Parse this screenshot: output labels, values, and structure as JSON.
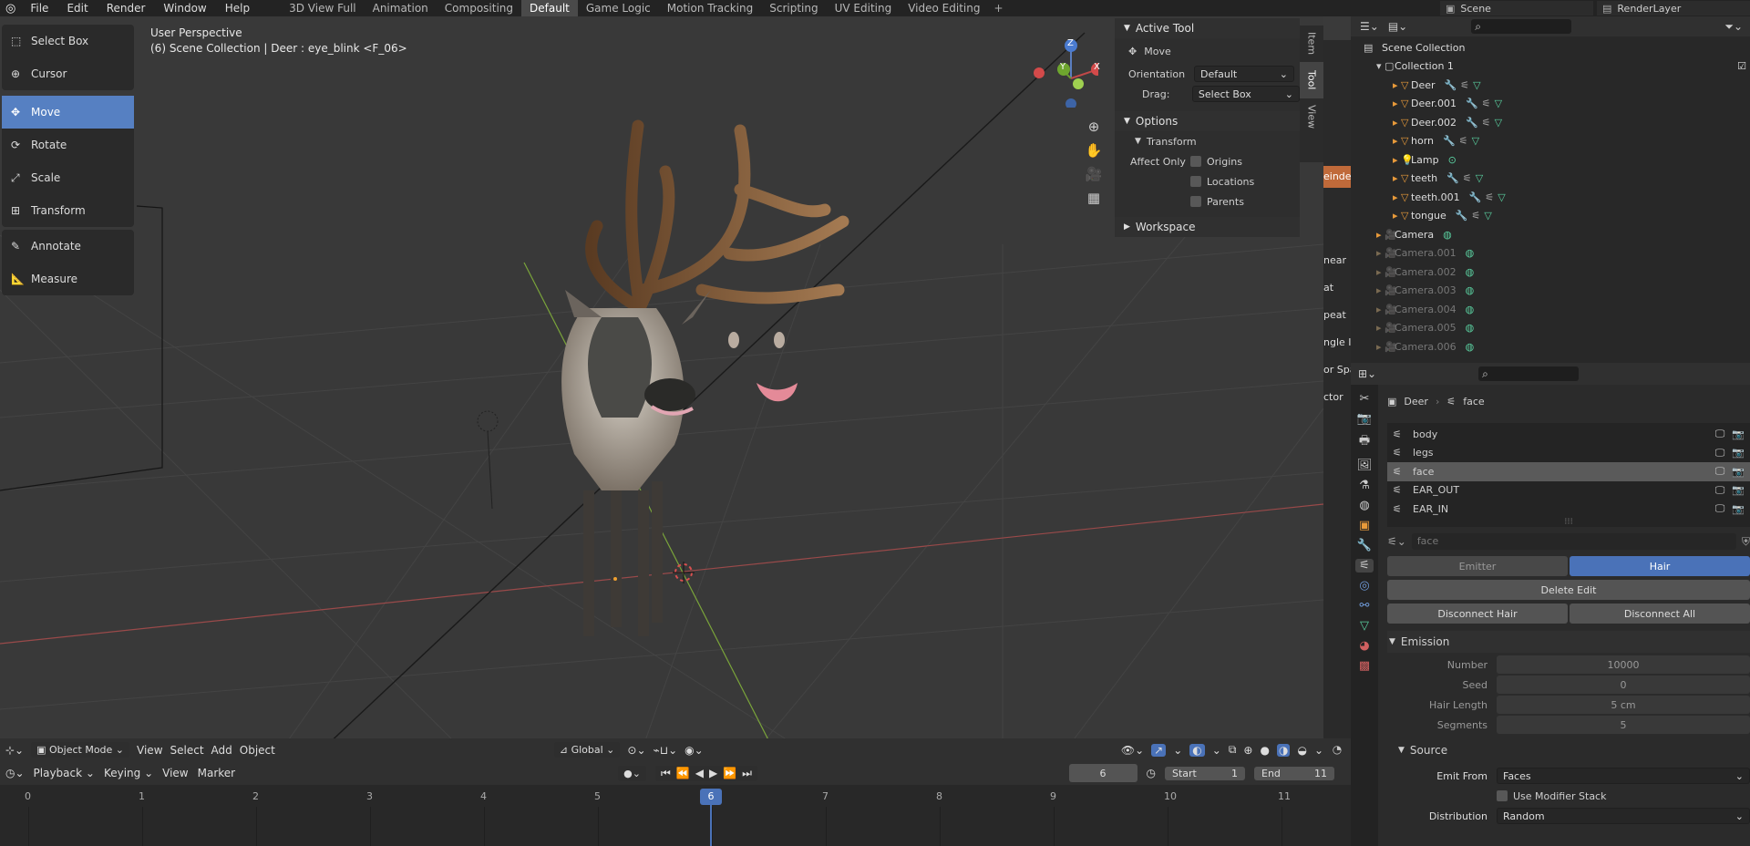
{
  "menus": [
    "File",
    "Edit",
    "Render",
    "Window",
    "Help"
  ],
  "workspaces": [
    "3D View Full",
    "Animation",
    "Compositing",
    "Default",
    "Game Logic",
    "Motion Tracking",
    "Scripting",
    "UV Editing",
    "Video Editing"
  ],
  "active_workspace": "Default",
  "scene_name": "Scene",
  "render_layer": "RenderLayer",
  "viewport": {
    "perspective": "User Perspective",
    "context": "(6) Scene Collection | Deer : eye_blink <F_06>"
  },
  "tools": [
    "Select Box",
    "Cursor",
    "Move",
    "Rotate",
    "Scale",
    "Transform",
    "Annotate",
    "Measure"
  ],
  "active_tool": "Move",
  "npanel": {
    "active_tool_header": "Active Tool",
    "tool_name": "Move",
    "orientation_label": "Orientation",
    "orientation_value": "Default",
    "drag_label": "Drag:",
    "drag_value": "Select Box",
    "options_header": "Options",
    "transform_header": "Transform",
    "affect_only": "Affect Only",
    "checkboxes": [
      "Origins",
      "Locations",
      "Parents"
    ],
    "workspace_header": "Workspace"
  },
  "npanel_tabs": [
    "Item",
    "Tool",
    "View"
  ],
  "clipped_panel": [
    "einde",
    "near",
    "at",
    "peat",
    "ngle In",
    "or Spa",
    "ctor"
  ],
  "viewport_header": {
    "mode": "Object Mode",
    "menus": [
      "View",
      "Select",
      "Add",
      "Object"
    ],
    "orientation": "Global"
  },
  "gizmo": {
    "x": "X",
    "y": "Y",
    "z": "Z"
  },
  "outliner": {
    "root": "Scene Collection",
    "collection": "Collection 1",
    "objects": [
      "Deer",
      "Deer.001",
      "Deer.002",
      "horn",
      "Lamp",
      "teeth",
      "teeth.001",
      "tongue"
    ],
    "cameras": [
      "Camera",
      "Camera.001",
      "Camera.002",
      "Camera.003",
      "Camera.004",
      "Camera.005",
      "Camera.006"
    ]
  },
  "props": {
    "breadcrumb_obj": "Deer",
    "breadcrumb_sys": "face",
    "systems": [
      "body",
      "legs",
      "face",
      "EAR_OUT",
      "EAR_IN"
    ],
    "active_system": "face",
    "name_field": "face",
    "emitter": "Emitter",
    "hair": "Hair",
    "delete_edit": "Delete Edit",
    "disconnect_hair": "Disconnect Hair",
    "disconnect_all": "Disconnect All",
    "emission": "Emission",
    "number_label": "Number",
    "number": "10000",
    "seed_label": "Seed",
    "seed": "0",
    "hair_length_label": "Hair Length",
    "hair_length": "5 cm",
    "segments_label": "Segments",
    "segments": "5",
    "source": "Source",
    "emit_from_label": "Emit From",
    "emit_from": "Faces",
    "use_modifier": "Use Modifier Stack",
    "distribution_label": "Distribution",
    "distribution": "Random"
  },
  "timeline": {
    "menus": [
      "Playback",
      "Keying",
      "View",
      "Marker"
    ],
    "current_frame": "6",
    "start_label": "Start",
    "start": "1",
    "end_label": "End",
    "end": "11",
    "ticks": [
      "0",
      "1",
      "2",
      "3",
      "4",
      "5",
      "6",
      "7",
      "8",
      "9",
      "10",
      "11"
    ]
  }
}
